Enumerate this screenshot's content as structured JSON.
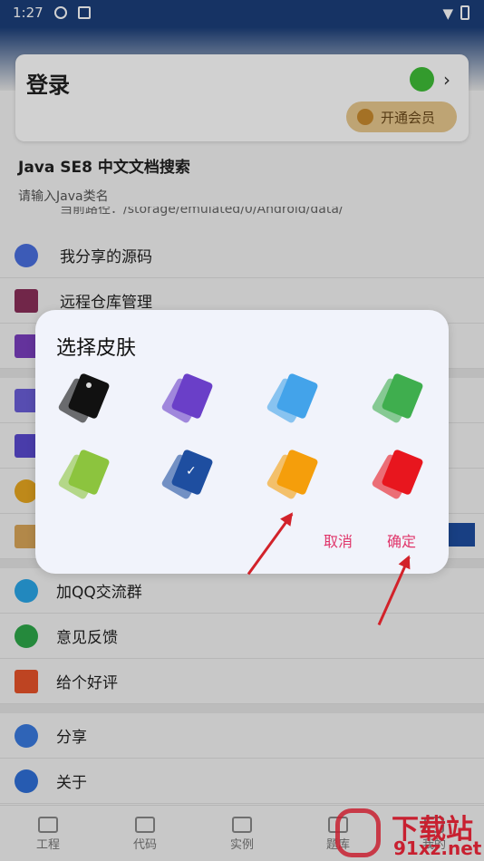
{
  "status_bar": {
    "time": "1:27"
  },
  "login_card": {
    "title": "登录",
    "vip_button": "开通会员"
  },
  "search": {
    "title": "Java SE8 中文文档搜索",
    "placeholder": "请输入Java类名",
    "path": "当前路径：/storage/emulated/0/Android/data/"
  },
  "menu": [
    {
      "label": "我分享的源码",
      "color": "#4a6fe0"
    },
    {
      "label": "远程仓库管理",
      "color": "#8a2f5a"
    },
    {
      "label": "",
      "color": "#7a3fbf"
    },
    {
      "label": "",
      "color": "#6b5fd8"
    },
    {
      "label": "",
      "color": "#5a4ad0"
    },
    {
      "label": "",
      "color": "#e8a820"
    },
    {
      "label": "",
      "color": "#d9a65a"
    }
  ],
  "menu2": [
    {
      "label": "加QQ交流群",
      "color": "#2aa6e8"
    },
    {
      "label": "意见反馈",
      "color": "#2ea84a"
    },
    {
      "label": "给个好评",
      "color": "#e8542a"
    }
  ],
  "menu3": [
    {
      "label": "分享",
      "color": "#3a7ae0"
    },
    {
      "label": "关于",
      "color": "#2f6fd8"
    }
  ],
  "tabs": [
    {
      "label": "工程"
    },
    {
      "label": "代码"
    },
    {
      "label": "实例"
    },
    {
      "label": "题库"
    },
    {
      "label": "我的"
    }
  ],
  "dialog": {
    "title": "选择皮肤",
    "skins": [
      {
        "name": "black",
        "color": "#111111",
        "selected": false
      },
      {
        "name": "purple",
        "color": "#6a3fc8",
        "selected": false
      },
      {
        "name": "blue",
        "color": "#43a3ea",
        "selected": false
      },
      {
        "name": "green",
        "color": "#3fae4e",
        "selected": false
      },
      {
        "name": "light-green",
        "color": "#8cc43e",
        "selected": false
      },
      {
        "name": "navy",
        "color": "#1e4ea0",
        "selected": true
      },
      {
        "name": "orange",
        "color": "#f59e0b",
        "selected": false
      },
      {
        "name": "red",
        "color": "#e8161e",
        "selected": false
      }
    ],
    "cancel": "取消",
    "confirm": "确定"
  },
  "watermark": {
    "line1": "下载站",
    "line2": "91xz.net"
  }
}
